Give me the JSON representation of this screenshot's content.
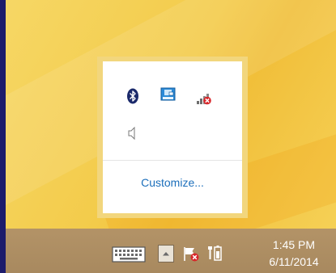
{
  "overflow_popup": {
    "icons": [
      {
        "name": "bluetooth-icon"
      },
      {
        "name": "network-manager-icon"
      },
      {
        "name": "network-disconnected-icon"
      },
      {
        "name": "speaker-icon"
      }
    ],
    "customize_label": "Customize..."
  },
  "taskbar": {
    "clock_time": "1:45 PM",
    "clock_date": "6/11/2014"
  },
  "colors": {
    "accent_link": "#1c6fbb",
    "popup_border": "#f2d67d",
    "taskbar": "#ab8c62",
    "frame": "#1d1b6b"
  }
}
